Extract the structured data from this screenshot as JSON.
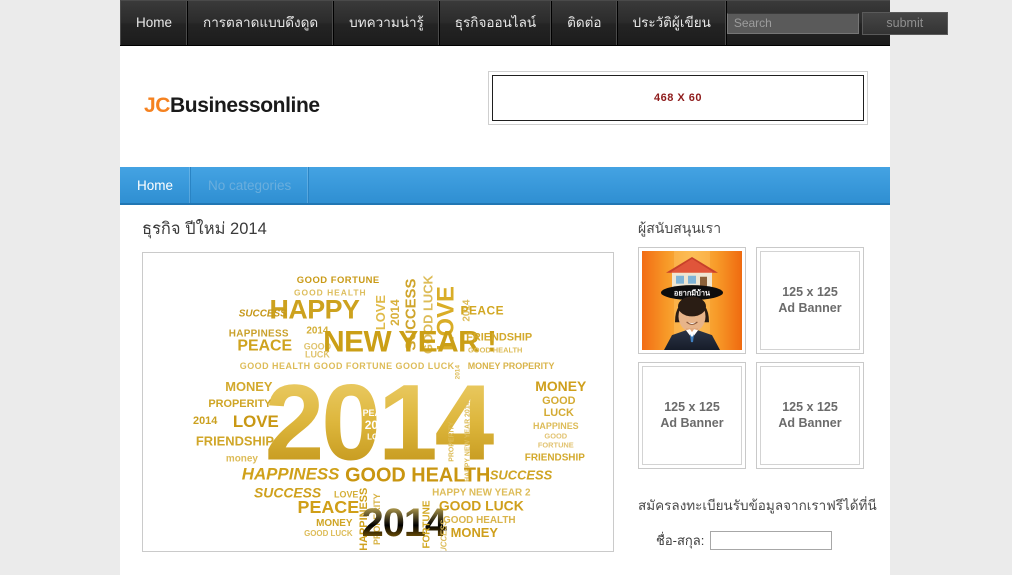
{
  "topnav": {
    "items": [
      {
        "label": "Home"
      },
      {
        "label": "การตลาดแบบดึงดูด"
      },
      {
        "label": "บทความน่ารู้"
      },
      {
        "label": "ธุรกิจออนไลน์"
      },
      {
        "label": "ติดต่อ"
      },
      {
        "label": "ประวัติผู้เขียน"
      }
    ],
    "search_placeholder": "Search",
    "search_value": "",
    "submit_label": "submit"
  },
  "header": {
    "logo_first": "JC",
    "logo_second": "Businessonline",
    "logo_accent_color": "#f58220",
    "ad_banner_label": "468 X 60",
    "ad_banner_color": "#8e1b1b"
  },
  "bluenav": {
    "items": [
      {
        "label": "Home",
        "muted": false
      },
      {
        "label": "No categories",
        "muted": true
      }
    ],
    "background_color": "#3498db"
  },
  "main": {
    "post_title": "ธุรกิจ ปีใหม่ 2014",
    "figure_alt": "word-cloud-2014"
  },
  "sidebar": {
    "sponsors_heading": "ผู้สนับสนุนเรา",
    "ads": [
      {
        "type": "photo",
        "label": "อยากมีบ้าน"
      },
      {
        "type": "placeholder",
        "line1": "125 x 125",
        "line2": "Ad Banner"
      },
      {
        "type": "placeholder",
        "line1": "125 x 125",
        "line2": "Ad Banner"
      },
      {
        "type": "placeholder",
        "line1": "125 x 125",
        "line2": "Ad Banner"
      }
    ],
    "subscribe": {
      "title": "สมัครลงทะเบียนรับข้อมูลจากเราฟรีได้ที่นี",
      "name_label": "ชื่อ-สกุล:",
      "name_value": "",
      "name_placeholder": ""
    }
  },
  "wordcloud": {
    "palette": {
      "dark": "#b8860b",
      "mid": "#d4a017",
      "light": "#e8c252",
      "pale": "#eed98a"
    },
    "words": [
      "GOOD FORTUNE",
      "GOOD HEALTH",
      "SUCCESS",
      "LOVE",
      "2014",
      "GOOD LUCK",
      "PEACE",
      "HAPPY",
      "NEW YEAR !",
      "HAPPINESS",
      "FRIENDSHIP",
      "MONEY",
      "PROPERITY",
      "HAPPY NEW YEAR 2014"
    ]
  }
}
